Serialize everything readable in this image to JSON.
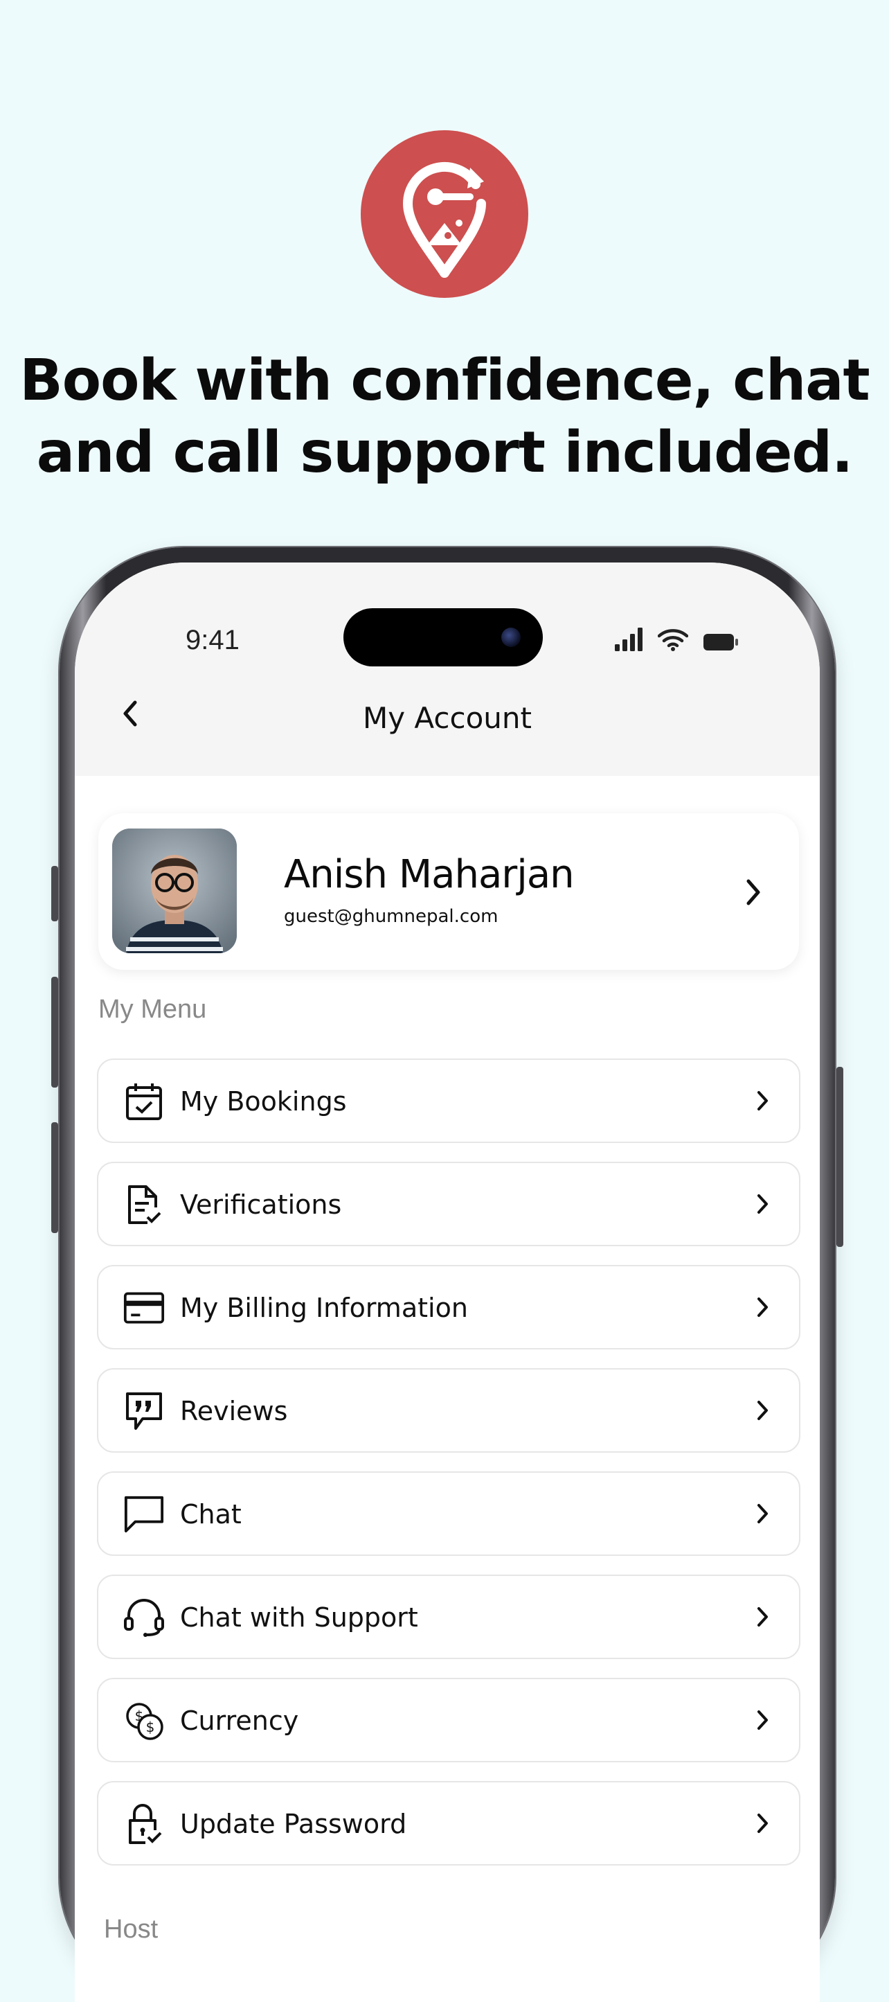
{
  "headline": {
    "line1": "Book with confidence, chat",
    "line2": "and call support included."
  },
  "logo": {
    "icon": "ghumnepal-logo-icon",
    "color": "#cd4f4f"
  },
  "status_bar": {
    "time": "9:41"
  },
  "nav": {
    "title": "My Account",
    "back_icon": "chevron-left-icon"
  },
  "profile": {
    "name": "Anish Maharjan",
    "email": "guest@ghumnepal.com"
  },
  "menu": {
    "section_label": "My Menu",
    "items": [
      {
        "label": "My Bookings",
        "icon": "calendar-check-icon"
      },
      {
        "label": "Verifications",
        "icon": "document-check-icon"
      },
      {
        "label": "My Billing Information",
        "icon": "credit-card-icon"
      },
      {
        "label": "Reviews",
        "icon": "review-quote-icon"
      },
      {
        "label": "Chat",
        "icon": "chat-bubble-icon"
      },
      {
        "label": "Chat with Support",
        "icon": "headset-icon"
      },
      {
        "label": "Currency",
        "icon": "currency-exchange-icon"
      },
      {
        "label": "Update Password",
        "icon": "lock-check-icon"
      }
    ]
  },
  "host_section": {
    "label": "Host"
  }
}
